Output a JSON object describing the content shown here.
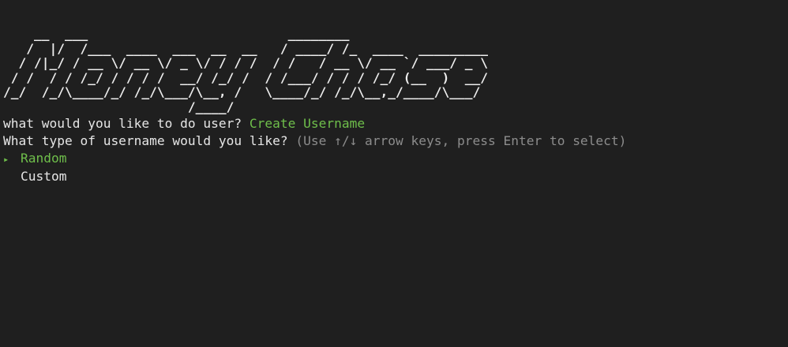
{
  "banner": {
    "ascii_art": "    __  ___                          ________\n   /  |/  /___  ____  ___  __  __   / ____/ /_  ____  _________\n  / /|_/ / __ \\/ __ \\/ _ \\/ / / /  / /   / __ \\/ __ `/ ___/ _ \\\n / /  / / /_/ / / / /  __/ /_/ /  / /___/ / / / /_/ (__  )  __/\n/_/  /_/\\____/_/ /_/\\___/\\__, /   \\____/_/ /_/\\__,_/____/\\___/\n                        /____/"
  },
  "prompt1": {
    "question": "what would you like to do user? ",
    "answer": "Create Username"
  },
  "prompt2": {
    "question": "What type of username would you like? ",
    "hint": "(Use ↑/↓ arrow keys, press Enter to select)"
  },
  "options": {
    "pointer": "▸",
    "items": [
      {
        "label": "Random"
      },
      {
        "label": "Custom"
      }
    ]
  },
  "colors": {
    "background": "#1f1f1f",
    "text": "#e6e6e6",
    "accent": "#6fbf4b",
    "hint": "#8c8c8c"
  }
}
